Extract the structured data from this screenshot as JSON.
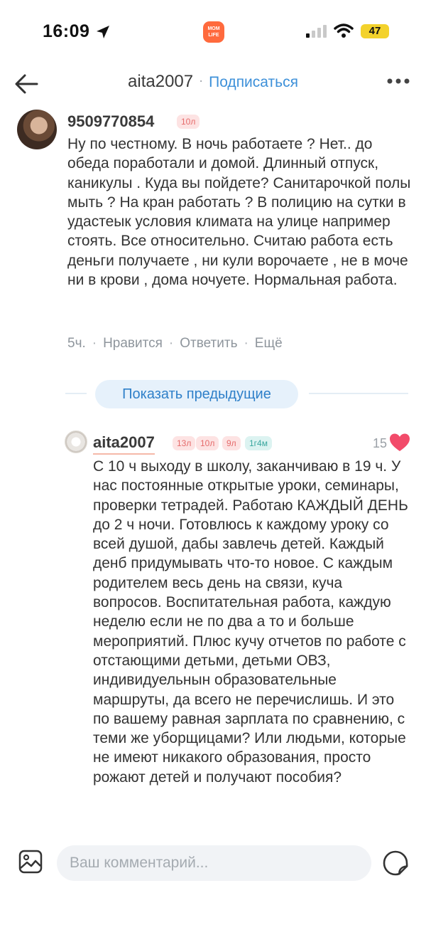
{
  "status": {
    "time": "16:09",
    "battery": "47",
    "app_badge_line1": "MOM",
    "app_badge_line2": "LIFE"
  },
  "header": {
    "username": "aita2007",
    "separator": "·",
    "subscribe_label": "Подписаться"
  },
  "comment1": {
    "author": "9509770854",
    "badges": [
      "10л"
    ],
    "text": "Ну по честному. В ночь работаете ? Нет.. до обеда поработали и домой. Длинный отпуск, каникулы . Куда вы пойдете? Санитарочкой полы мыть ? На кран работать ? В полицию на сутки в удастеык условия климата на улице например стоять. Все относительно. Считаю работа есть деньги получаете , ни кули ворочаете , не в моче ни в крови , дома ночуете. Нормальная работа.",
    "time": "5ч.",
    "like_label": "Нравится",
    "reply_label": "Ответить",
    "more_label": "Ещё",
    "separator": "·"
  },
  "show_previous_label": "Показать предыдущие",
  "comment2": {
    "author": "aita2007",
    "badges": [
      {
        "label": "13л",
        "color": "pink"
      },
      {
        "label": "10л",
        "color": "pink"
      },
      {
        "label": "9л",
        "color": "pink"
      },
      {
        "label": "1г4м",
        "color": "teal"
      }
    ],
    "likes": "15",
    "text": "С 10 ч выходу в школу, заканчиваю в 19 ч. У нас постоянные открытые уроки, семинары, проверки тетрадей. Работаю КАЖДЫЙ ДЕНЬ до 2 ч ночи. Готовлюсь к каждому уроку со всей душой, дабы завлечь детей. Каждый денб придумывать что-то новое. С каждым родителем весь день на связи, куча вопросов. Воспитательная работа, каждую неделю если не по два а то и больше мероприятий. Плюс кучу отчетов по работе с отстающими детьми, детьми ОВЗ, индивидуельнын образовательные маршруты, да всего не перечислишь. И это по вашему равная зарплата по сравнению, с теми же уборщицами? Или людьми, которые не имеют никакого образования, просто рожают детей и получают пособия?"
  },
  "composer": {
    "placeholder": "Ваш комментарий..."
  },
  "colors": {
    "accent": "#3d90d9",
    "heart": "#f24b6a",
    "badge_pink_bg": "#fde3e3",
    "badge_teal_bg": "#dcf3f1"
  }
}
